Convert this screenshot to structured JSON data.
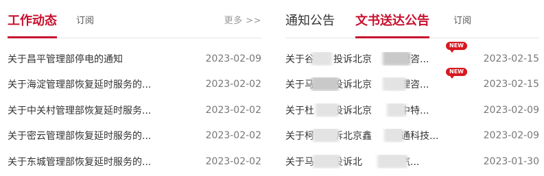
{
  "left": {
    "tab_active": "工作动态",
    "subscribe": "订阅",
    "more": "更多 >>",
    "items": [
      {
        "title": "关于昌平管理部停电的通知",
        "date": "2023-02-09"
      },
      {
        "title": "关于海淀管理部恢复延时服务的...",
        "date": "2023-02-02"
      },
      {
        "title": "关于中关村管理部恢复延时服务...",
        "date": "2023-02-02"
      },
      {
        "title": "关于密云管理部恢复延时服务的...",
        "date": "2023-02-02"
      },
      {
        "title": "关于东城管理部恢复延时服务的...",
        "date": "2023-02-02"
      }
    ]
  },
  "right": {
    "tab_inactive": "通知公告",
    "tab_active": "文书送达公告",
    "subscribe": "订阅",
    "badge": "NEW",
    "items": [
      {
        "title": "关于谷　　投诉北京　　管理咨...",
        "date": "2023-02-15",
        "is_new": true
      },
      {
        "title": "关于马　　投诉北京　　管理咨...",
        "date": "2023-02-15",
        "is_new": true
      },
      {
        "title": "关于杜　　投诉北京　　代中特...",
        "date": "2023-02-09",
        "is_new": false
      },
      {
        "title": "关于柯　　诉北京鑫　　大通科技...",
        "date": "2023-02-09",
        "is_new": false
      },
      {
        "title": "关于马　　投诉北　　出租汽...",
        "date": "2023-01-30",
        "is_new": false
      }
    ]
  },
  "colors": {
    "accent": "#c8102e",
    "badge": "#d71920",
    "date": "#777777",
    "muted": "#999999"
  }
}
